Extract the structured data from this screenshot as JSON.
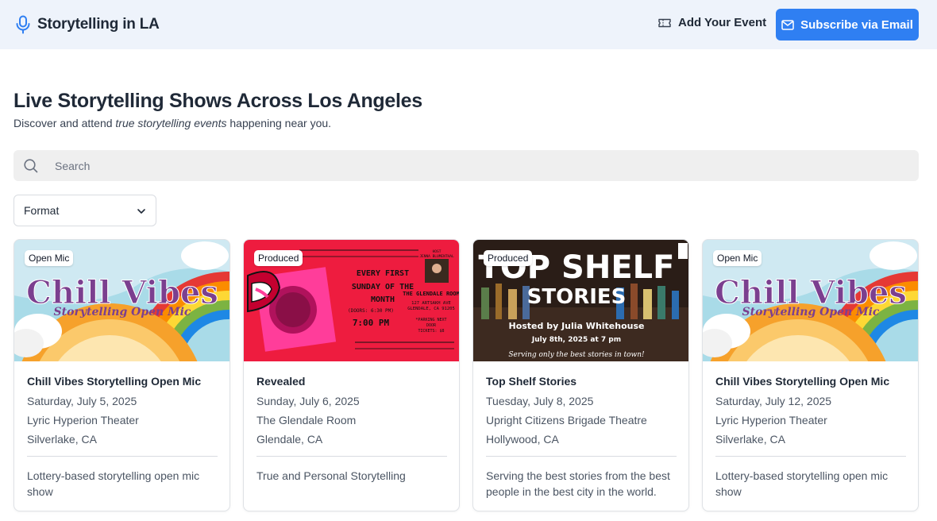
{
  "header": {
    "brand": "Storytelling in LA",
    "add_event": "Add Your Event",
    "subscribe": "Subscribe via Email"
  },
  "intro": {
    "title": "Live Storytelling Shows Across Los Angeles",
    "subtitle_pre": "Discover and attend ",
    "subtitle_em": "true storytelling events",
    "subtitle_post": " happening near you."
  },
  "search": {
    "placeholder": "Search",
    "value": ""
  },
  "filters": {
    "format_label": "Format"
  },
  "colors": {
    "accent": "#2f7ff2",
    "header_bg": "#eef3fb"
  },
  "events": [
    {
      "badge": "Open Mic",
      "title": "Chill Vibes Storytelling Open Mic",
      "date": "Saturday, July 5, 2025",
      "venue": "Lyric Hyperion Theater",
      "city": "Silverlake, CA",
      "description": "Lottery-based storytelling open mic show",
      "poster": {
        "line1": "Chill Vibes",
        "line2": "Storytelling Open Mic"
      }
    },
    {
      "badge": "Produced",
      "title": "Revealed",
      "date": "Sunday, July 6, 2025",
      "venue": "The Glendale Room",
      "city": "Glendale, CA",
      "description": "True and Personal Storytelling",
      "poster": {
        "line1": "EVERY FIRST",
        "line2": "SUNDAY OF THE",
        "line3": "MONTH",
        "line4": "(DOORS: 6:30 PM)",
        "line5": "7:00 PM",
        "venue": "THE GLENDALE ROOM",
        "address": "127 ARTSAKH AVE",
        "address2": "GLENDALE, CA 91205",
        "parking": "*PARKING NEXT",
        "parking2": "DOOR",
        "tickets": "TICKETS: $8",
        "host": "HOST",
        "host_name": "JENNA BLUMENTHAL"
      }
    },
    {
      "badge": "Produced",
      "title": "Top Shelf Stories",
      "date": "Tuesday, July 8, 2025",
      "venue": "Upright Citizens Brigade Theatre",
      "city": "Hollywood, CA",
      "description": "Serving the best stories from the best people in the best city in the world.",
      "poster": {
        "line1": "TOP SHELF",
        "line2": "STORIES",
        "host": "Hosted by Julia Whitehouse",
        "when": "July 8th, 2025 at 7 pm",
        "tag": "Serving only the best stories in town!"
      }
    },
    {
      "badge": "Open Mic",
      "title": "Chill Vibes Storytelling Open Mic",
      "date": "Saturday, July 12, 2025",
      "venue": "Lyric Hyperion Theater",
      "city": "Silverlake, CA",
      "description": "Lottery-based storytelling open mic show",
      "poster": {
        "line1": "Chill Vibes",
        "line2": "Storytelling Open Mic"
      }
    }
  ]
}
